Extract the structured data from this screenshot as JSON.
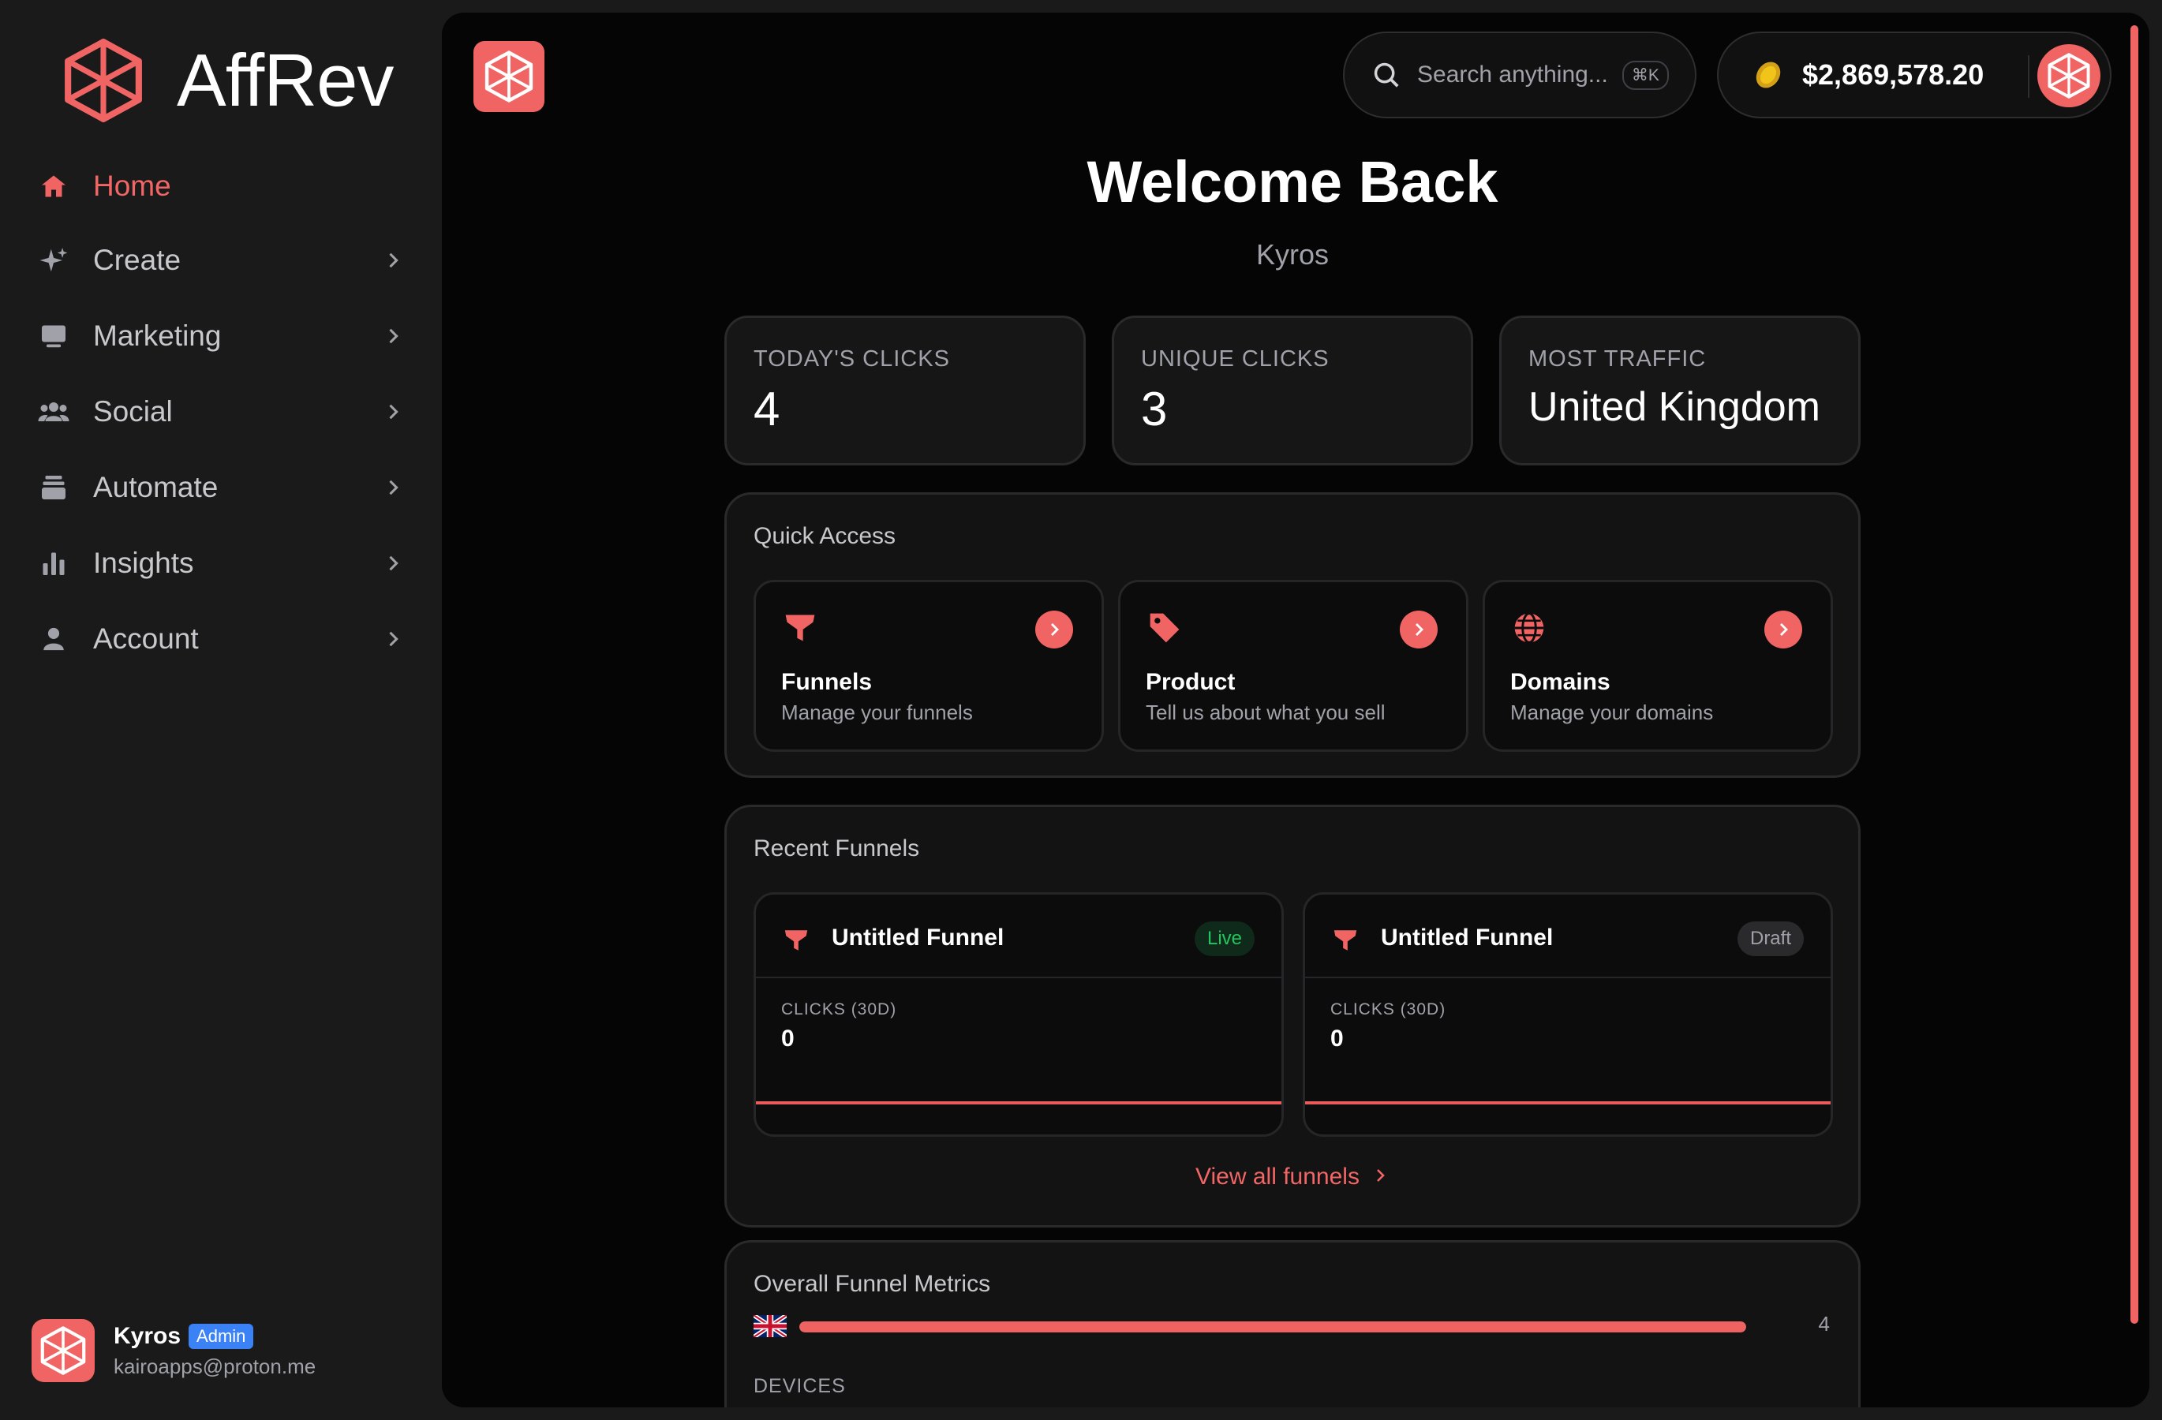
{
  "brand": {
    "name": "AffRev",
    "accent_color": "#f16464"
  },
  "sidebar": {
    "items": [
      {
        "label": "Home",
        "icon": "home-icon",
        "active": true,
        "has_chevron": false
      },
      {
        "label": "Create",
        "icon": "sparkle-icon",
        "active": false,
        "has_chevron": true
      },
      {
        "label": "Marketing",
        "icon": "monitor-icon",
        "active": false,
        "has_chevron": true
      },
      {
        "label": "Social",
        "icon": "users-icon",
        "active": false,
        "has_chevron": true
      },
      {
        "label": "Automate",
        "icon": "stack-icon",
        "active": false,
        "has_chevron": true
      },
      {
        "label": "Insights",
        "icon": "bar-chart-icon",
        "active": false,
        "has_chevron": true
      },
      {
        "label": "Account",
        "icon": "user-icon",
        "active": false,
        "has_chevron": true
      }
    ]
  },
  "user": {
    "name": "Kyros",
    "role": "Admin",
    "email": "kairoapps@proton.me"
  },
  "header": {
    "search_placeholder": "Search anything...",
    "shortcut": "⌘K",
    "balance": "$2,869,578.20"
  },
  "welcome": {
    "title": "Welcome Back",
    "name": "Kyros"
  },
  "stats": [
    {
      "label": "TODAY'S CLICKS",
      "value": "4"
    },
    {
      "label": "UNIQUE CLICKS",
      "value": "3"
    },
    {
      "label": "MOST TRAFFIC",
      "value": "United Kingdom"
    }
  ],
  "quick_access": {
    "title": "Quick Access",
    "items": [
      {
        "title": "Funnels",
        "desc": "Manage your funnels",
        "icon": "funnel-icon"
      },
      {
        "title": "Product",
        "desc": "Tell us about what you sell",
        "icon": "tag-icon"
      },
      {
        "title": "Domains",
        "desc": "Manage your domains",
        "icon": "globe-icon"
      }
    ]
  },
  "recent_funnels": {
    "title": "Recent Funnels",
    "items": [
      {
        "name": "Untitled Funnel",
        "status": "Live",
        "metric_label": "CLICKS (30D)",
        "metric_value": "0"
      },
      {
        "name": "Untitled Funnel",
        "status": "Draft",
        "metric_label": "CLICKS (30D)",
        "metric_value": "0"
      }
    ],
    "view_all": "View all funnels"
  },
  "overall_metrics": {
    "title": "Overall Funnel Metrics",
    "countries": [
      {
        "flag": "uk-flag-icon",
        "value": "4",
        "fill": 1.0
      }
    ],
    "devices_label": "DEVICES"
  }
}
